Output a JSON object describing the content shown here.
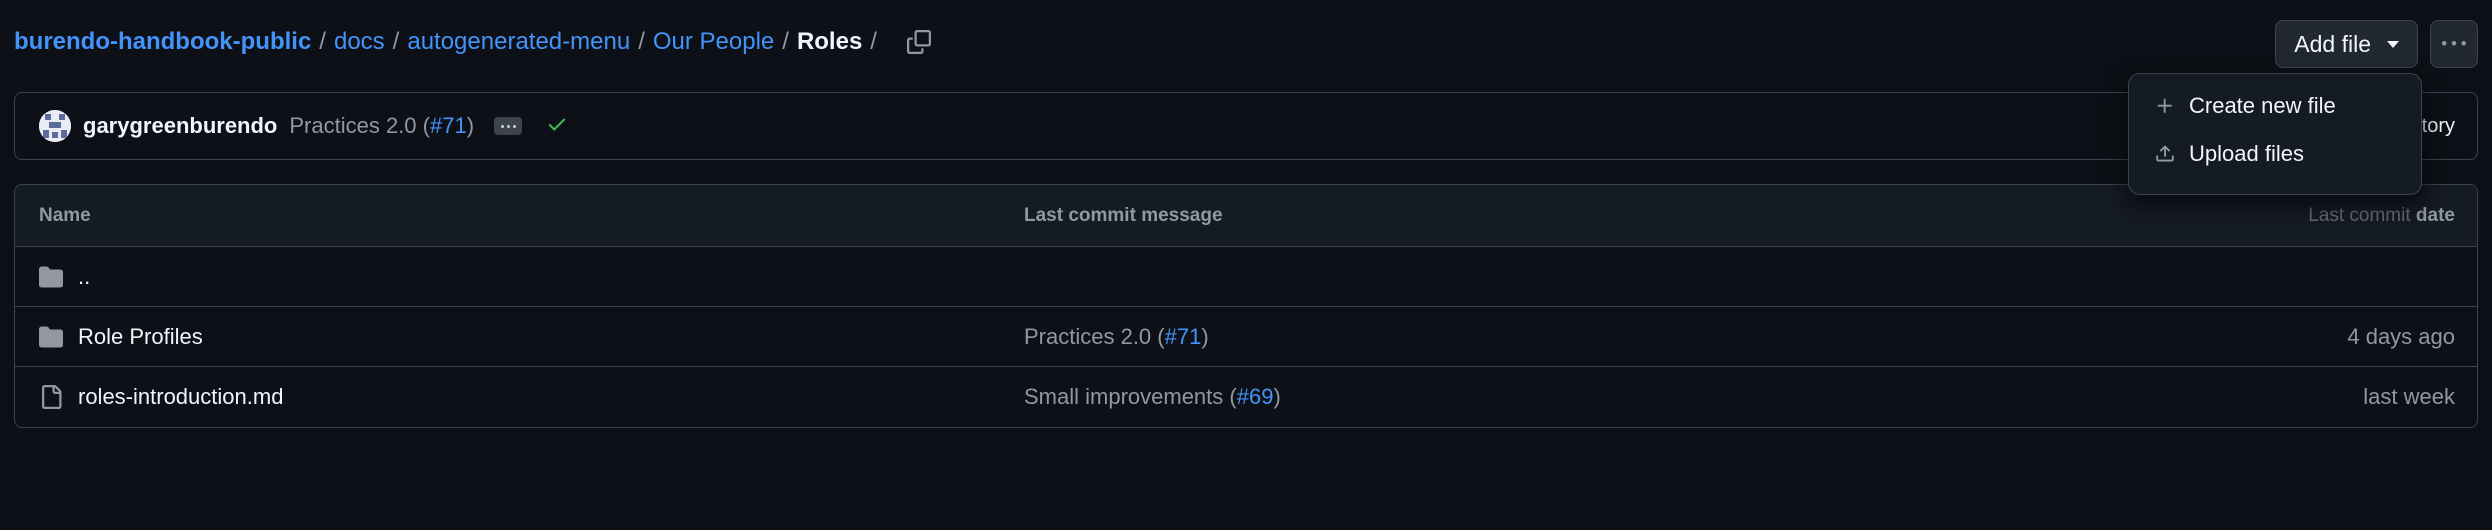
{
  "breadcrumb": {
    "repo": "burendo-handbook-public",
    "path": [
      "docs",
      "autogenerated-menu",
      "Our People"
    ],
    "current": "Roles",
    "separator": "/"
  },
  "actions": {
    "add_file_label": "Add file",
    "more_icon": "kebab-horizontal-icon"
  },
  "menu": {
    "items": [
      {
        "label": "Create new file",
        "icon": "plus-icon"
      },
      {
        "label": "Upload files",
        "icon": "upload-icon"
      }
    ]
  },
  "commit": {
    "author": "garygreenburendo",
    "message_prefix": "Practices 2.0 (",
    "pr": "#71",
    "message_suffix": ")",
    "history_label": "tory",
    "status_color": "#3fb950"
  },
  "table": {
    "headers": {
      "name": "Name",
      "message": "Last commit message",
      "date_dim": "Last commit",
      "date_bold": "date"
    },
    "parent": "..",
    "rows": [
      {
        "name": "Role Profiles",
        "type": "folder",
        "msg_prefix": "Practices 2.0 (",
        "pr": "#71",
        "msg_suffix": ")",
        "date": "4 days ago"
      },
      {
        "name": "roles-introduction.md",
        "type": "file",
        "msg_prefix": "Small improvements (",
        "pr": "#69",
        "msg_suffix": ")",
        "date": "last week"
      }
    ]
  },
  "colors": {
    "background": "#0d1117",
    "accent": "#4493f8",
    "border": "#3d444d",
    "muted": "#9198a1"
  }
}
